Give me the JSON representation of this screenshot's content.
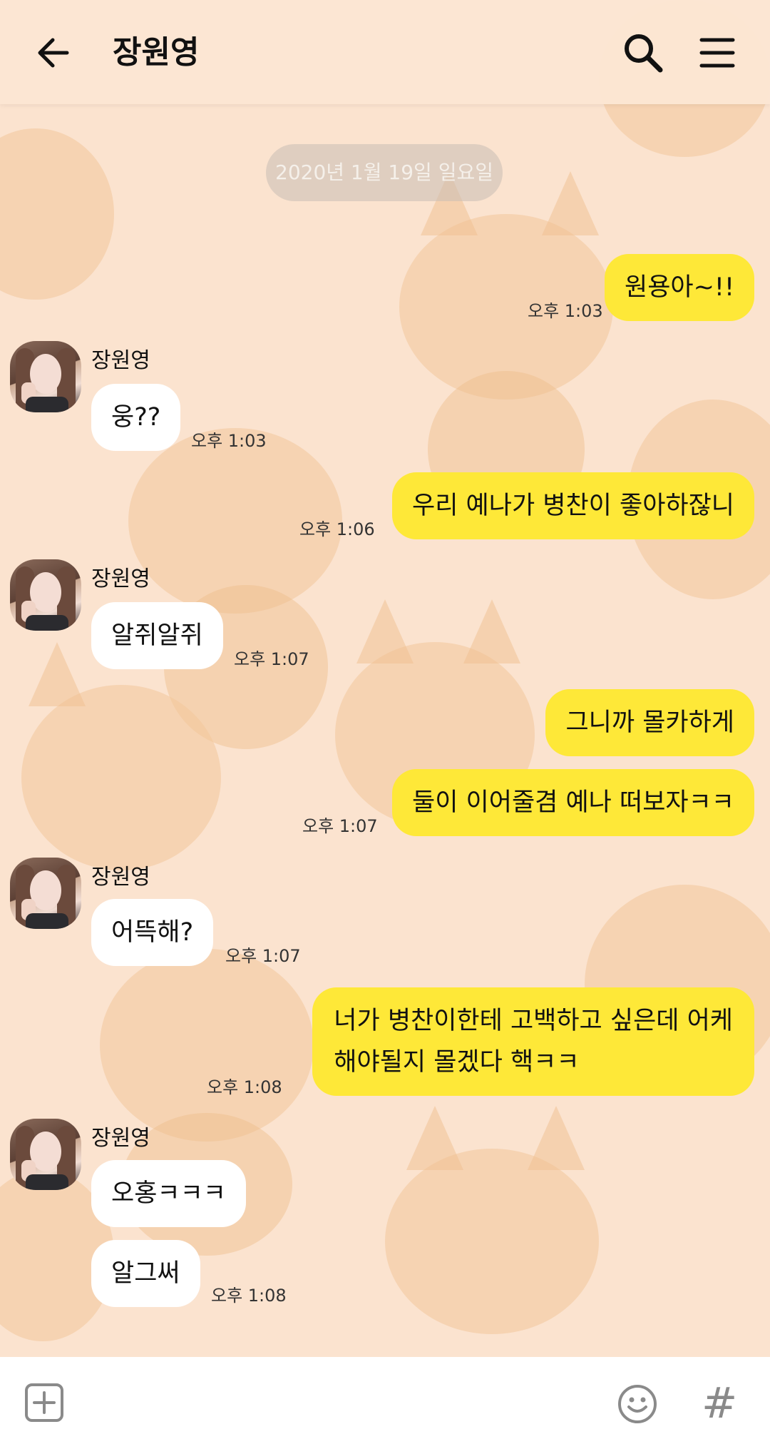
{
  "header": {
    "title": "장원영"
  },
  "date_divider": "2020년 1월 19일 일요일",
  "contact_name": "장원영",
  "messages": {
    "m1": {
      "text": "원용아~!!",
      "time": "오후 1:03"
    },
    "m2": {
      "text": "웅??",
      "time": "오후 1:03"
    },
    "m3": {
      "text": "우리 예나가 병찬이 좋아하잖니",
      "time": "오후 1:06"
    },
    "m4": {
      "text": "알쥐알쥐",
      "time": "오후 1:07"
    },
    "m5": {
      "text": "그니까 몰카하게"
    },
    "m6": {
      "text": "둘이 이어줄겸 예나 떠보자ㅋㅋ",
      "time": "오후 1:07"
    },
    "m7": {
      "text": "어뜩해?",
      "time": "오후 1:07"
    },
    "m8": {
      "line1": "너가 병찬이한테 고백하고 싶은데 어케",
      "line2": "해야될지 몰겠다 핵ㅋㅋ",
      "time": "오후 1:08"
    },
    "m9": {
      "text": "오홍ㅋㅋㅋ"
    },
    "m10": {
      "text": "알그써",
      "time": "오후 1:08"
    }
  },
  "colors": {
    "my_bubble": "#fee838",
    "their_bubble": "#ffffff",
    "background": "#fbe3cf"
  },
  "icons": [
    "back-arrow-icon",
    "search-icon",
    "menu-icon",
    "plus-icon",
    "emoji-icon",
    "hash-icon"
  ]
}
